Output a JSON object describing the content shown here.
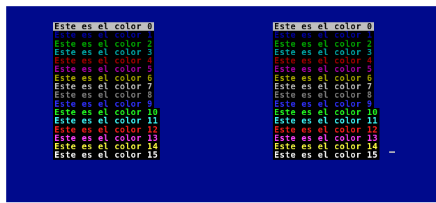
{
  "screen": {
    "background": "#000a8c",
    "cursor": "_"
  },
  "left_block": {
    "lines": [
      {
        "text": "Este es el color 0",
        "fg": "#000000",
        "bg": "#c0c0c0"
      },
      {
        "text": "Este es el color 1",
        "fg": "#0000a8",
        "bg": "#000000"
      },
      {
        "text": "Este es el color 2",
        "fg": "#00a800",
        "bg": "#000000"
      },
      {
        "text": "Este es el color 3",
        "fg": "#00a8a8",
        "bg": "#000000"
      },
      {
        "text": "Este es el color 4",
        "fg": "#a80000",
        "bg": "#000000"
      },
      {
        "text": "Este es el color 5",
        "fg": "#a800a8",
        "bg": "#000000"
      },
      {
        "text": "Este es el color 6",
        "fg": "#a8a800",
        "bg": "#000000"
      },
      {
        "text": "Este es el color 7",
        "fg": "#c0c0c0",
        "bg": "#000000"
      },
      {
        "text": "Este es el color 8",
        "fg": "#808080",
        "bg": "#000000"
      },
      {
        "text": "Este es el color 9",
        "fg": "#3030ff",
        "bg": "#000000"
      },
      {
        "text": "Este es el color 10",
        "fg": "#22ff22",
        "bg": "#000000"
      },
      {
        "text": "Este es el color 11",
        "fg": "#40ffff",
        "bg": "#000000"
      },
      {
        "text": "Este es el color 12",
        "fg": "#ff2020",
        "bg": "#000000"
      },
      {
        "text": "Este es el color 13",
        "fg": "#ff40ff",
        "bg": "#000000"
      },
      {
        "text": "Este es el color 14",
        "fg": "#ffff40",
        "bg": "#000000"
      },
      {
        "text": "Este es el color 15",
        "fg": "#ffffff",
        "bg": "#000000"
      }
    ]
  },
  "right_block": {
    "lines": [
      {
        "text": "Este es el color 0",
        "fg": "#000000",
        "bg": "#c0c0c0"
      },
      {
        "text": "Este es el color 1",
        "fg": "#0000a8",
        "bg": "#000000"
      },
      {
        "text": "Este es el color 2",
        "fg": "#00a800",
        "bg": "#000000"
      },
      {
        "text": "Este es el color 3",
        "fg": "#00a8a8",
        "bg": "#000000"
      },
      {
        "text": "Este es el color 4",
        "fg": "#a80000",
        "bg": "#000000"
      },
      {
        "text": "Este es el color 5",
        "fg": "#a800a8",
        "bg": "#000000"
      },
      {
        "text": "Este es el color 6",
        "fg": "#a8a800",
        "bg": "#000000"
      },
      {
        "text": "Este es el color 7",
        "fg": "#c0c0c0",
        "bg": "#000000"
      },
      {
        "text": "Este es el color 8",
        "fg": "#808080",
        "bg": "#000000"
      },
      {
        "text": "Este es el color 9",
        "fg": "#3030ff",
        "bg": "#000000"
      },
      {
        "text": "Este es el color 10",
        "fg": "#22ff22",
        "bg": "#000000"
      },
      {
        "text": "Este es el color 11",
        "fg": "#40ffff",
        "bg": "#000000"
      },
      {
        "text": "Este es el color 12",
        "fg": "#ff2020",
        "bg": "#000000"
      },
      {
        "text": "Este es el color 13",
        "fg": "#ff40ff",
        "bg": "#000000"
      },
      {
        "text": "Este es el color 14",
        "fg": "#ffff40",
        "bg": "#000000"
      },
      {
        "text": "Este es el color 15",
        "fg": "#ffffff",
        "bg": "#000000"
      }
    ]
  }
}
